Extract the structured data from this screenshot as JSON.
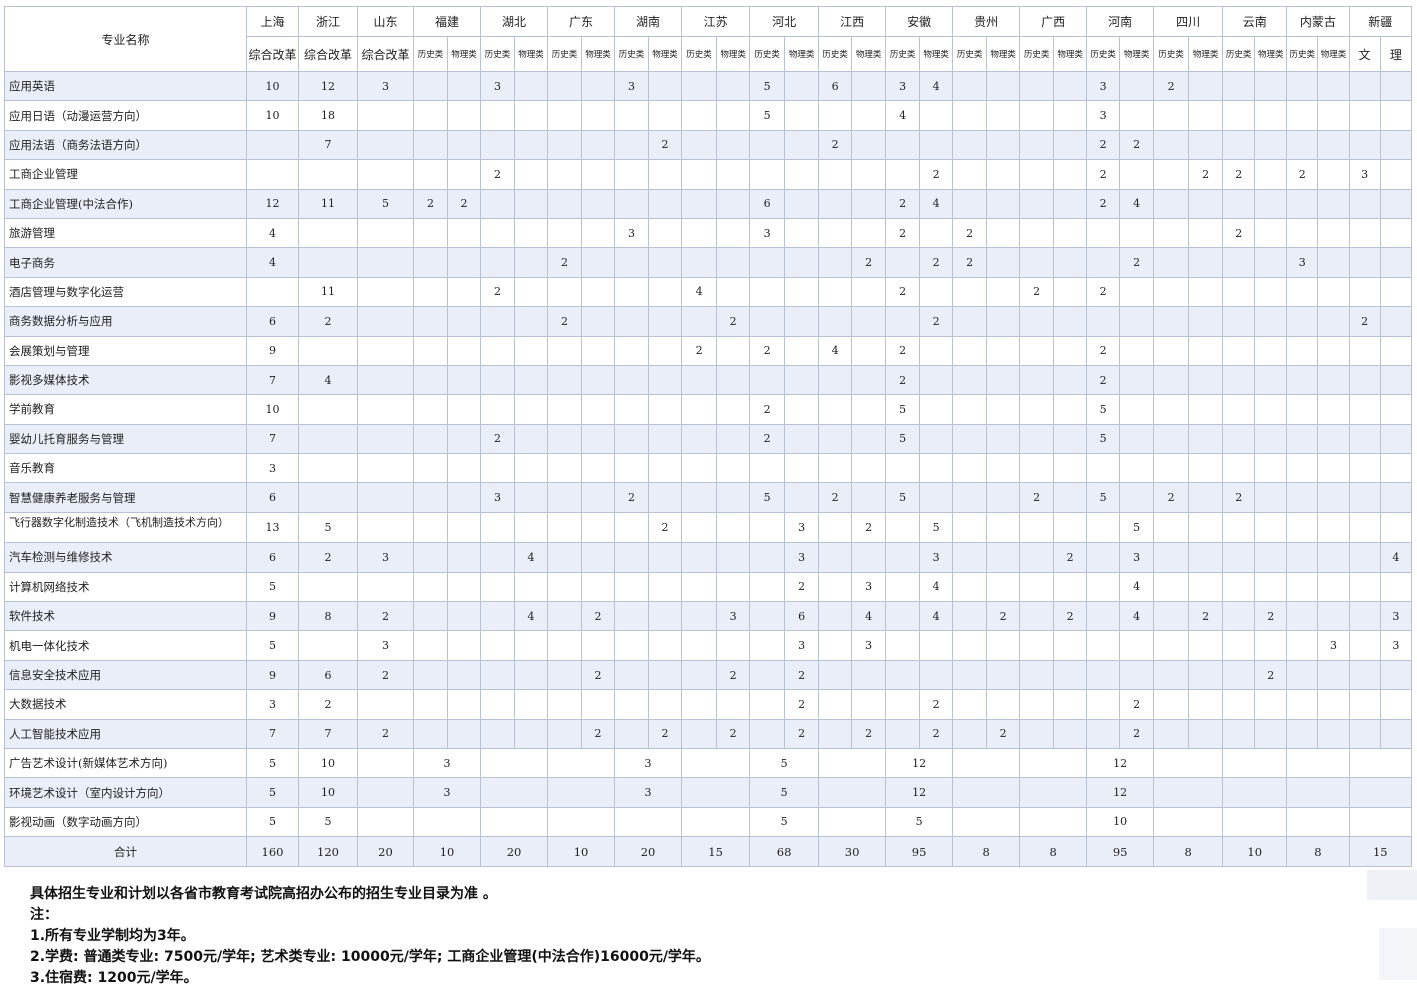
{
  "table": {
    "corner": "专业名称",
    "provinces": [
      {
        "name": "上海",
        "subs": [
          "综合改革"
        ]
      },
      {
        "name": "浙江",
        "subs": [
          "综合改革"
        ]
      },
      {
        "name": "山东",
        "subs": [
          "综合改革"
        ]
      },
      {
        "name": "福建",
        "subs": [
          "历史类",
          "物理类"
        ]
      },
      {
        "name": "湖北",
        "subs": [
          "历史类",
          "物理类"
        ]
      },
      {
        "name": "广东",
        "subs": [
          "历史类",
          "物理类"
        ]
      },
      {
        "name": "湖南",
        "subs": [
          "历史类",
          "物理类"
        ]
      },
      {
        "name": "江苏",
        "subs": [
          "历史类",
          "物理类"
        ]
      },
      {
        "name": "河北",
        "subs": [
          "历史类",
          "物理类"
        ]
      },
      {
        "name": "江西",
        "subs": [
          "历史类",
          "物理类"
        ]
      },
      {
        "name": "安徽",
        "subs": [
          "历史类",
          "物理类"
        ]
      },
      {
        "name": "贵州",
        "subs": [
          "历史类",
          "物理类"
        ]
      },
      {
        "name": "广西",
        "subs": [
          "历史类",
          "物理类"
        ]
      },
      {
        "name": "河南",
        "subs": [
          "历史类",
          "物理类"
        ]
      },
      {
        "name": "四川",
        "subs": [
          "历史类",
          "物理类"
        ]
      },
      {
        "name": "云南",
        "subs": [
          "历史类",
          "物理类"
        ]
      },
      {
        "name": "内蒙古",
        "subs": [
          "历史类",
          "物理类"
        ]
      },
      {
        "name": "新疆",
        "subs": [
          "文",
          "理"
        ]
      }
    ],
    "rows": [
      {
        "name": "应用英语",
        "cells": [
          {
            "c": 0,
            "v": "10"
          },
          {
            "c": 1,
            "v": "12"
          },
          {
            "c": 2,
            "v": "3"
          },
          {
            "c": 5,
            "v": "3"
          },
          {
            "c": 9,
            "v": "3"
          },
          {
            "c": 13,
            "v": "5"
          },
          {
            "c": 15,
            "v": "6"
          },
          {
            "c": 17,
            "v": "3"
          },
          {
            "c": 18,
            "v": "4"
          },
          {
            "c": 23,
            "v": "3"
          },
          {
            "c": 25,
            "v": "2"
          }
        ]
      },
      {
        "name": "应用日语（动漫运营方向）",
        "cells": [
          {
            "c": 0,
            "v": "10"
          },
          {
            "c": 1,
            "v": "18"
          },
          {
            "c": 13,
            "v": "5"
          },
          {
            "c": 17,
            "v": "4"
          },
          {
            "c": 23,
            "v": "3"
          }
        ]
      },
      {
        "name": "应用法语（商务法语方向）",
        "cells": [
          {
            "c": 1,
            "v": "7"
          },
          {
            "c": 10,
            "v": "2"
          },
          {
            "c": 15,
            "v": "2"
          },
          {
            "c": 23,
            "v": "2"
          },
          {
            "c": 24,
            "v": "2"
          }
        ]
      },
      {
        "name": "工商企业管理",
        "cells": [
          {
            "c": 5,
            "v": "2"
          },
          {
            "c": 18,
            "v": "2"
          },
          {
            "c": 23,
            "v": "2"
          },
          {
            "c": 26,
            "v": "2"
          },
          {
            "c": 27,
            "v": "2"
          },
          {
            "c": 29,
            "v": "2"
          },
          {
            "c": 31,
            "v": "3"
          }
        ]
      },
      {
        "name": "工商企业管理(中法合作)",
        "cells": [
          {
            "c": 0,
            "v": "12"
          },
          {
            "c": 1,
            "v": "11"
          },
          {
            "c": 2,
            "v": "5"
          },
          {
            "c": 3,
            "v": "2"
          },
          {
            "c": 4,
            "v": "2"
          },
          {
            "c": 13,
            "v": "6"
          },
          {
            "c": 17,
            "v": "2"
          },
          {
            "c": 18,
            "v": "4"
          },
          {
            "c": 23,
            "v": "2"
          },
          {
            "c": 24,
            "v": "4"
          }
        ]
      },
      {
        "name": "旅游管理",
        "cells": [
          {
            "c": 0,
            "v": "4"
          },
          {
            "c": 9,
            "v": "3"
          },
          {
            "c": 13,
            "v": "3"
          },
          {
            "c": 17,
            "v": "2"
          },
          {
            "c": 19,
            "v": "2"
          },
          {
            "c": 27,
            "v": "2"
          }
        ]
      },
      {
        "name": "电子商务",
        "cells": [
          {
            "c": 0,
            "v": "4"
          },
          {
            "c": 7,
            "v": "2"
          },
          {
            "c": 16,
            "v": "2"
          },
          {
            "c": 18,
            "v": "2"
          },
          {
            "c": 19,
            "v": "2"
          },
          {
            "c": 24,
            "v": "2"
          },
          {
            "c": 29,
            "v": "3"
          }
        ]
      },
      {
        "name": "酒店管理与数字化运营",
        "cells": [
          {
            "c": 1,
            "v": "11"
          },
          {
            "c": 5,
            "v": "2"
          },
          {
            "c": 11,
            "v": "4"
          },
          {
            "c": 17,
            "v": "2"
          },
          {
            "c": 21,
            "v": "2"
          },
          {
            "c": 23,
            "v": "2"
          }
        ]
      },
      {
        "name": "商务数据分析与应用",
        "cells": [
          {
            "c": 0,
            "v": "6"
          },
          {
            "c": 1,
            "v": "2"
          },
          {
            "c": 7,
            "v": "2"
          },
          {
            "c": 12,
            "v": "2"
          },
          {
            "c": 18,
            "v": "2"
          },
          {
            "c": 31,
            "v": "2"
          }
        ]
      },
      {
        "name": "会展策划与管理",
        "cells": [
          {
            "c": 0,
            "v": "9"
          },
          {
            "c": 11,
            "v": "2"
          },
          {
            "c": 13,
            "v": "2"
          },
          {
            "c": 15,
            "v": "4"
          },
          {
            "c": 17,
            "v": "2"
          },
          {
            "c": 23,
            "v": "2"
          }
        ]
      },
      {
        "name": "影视多媒体技术",
        "cells": [
          {
            "c": 0,
            "v": "7"
          },
          {
            "c": 1,
            "v": "4"
          },
          {
            "c": 17,
            "v": "2"
          },
          {
            "c": 23,
            "v": "2"
          }
        ]
      },
      {
        "name": "学前教育",
        "cells": [
          {
            "c": 0,
            "v": "10"
          },
          {
            "c": 13,
            "v": "2"
          },
          {
            "c": 17,
            "v": "5"
          },
          {
            "c": 23,
            "v": "5"
          }
        ]
      },
      {
        "name": "婴幼儿托育服务与管理",
        "cells": [
          {
            "c": 0,
            "v": "7"
          },
          {
            "c": 5,
            "v": "2"
          },
          {
            "c": 13,
            "v": "2"
          },
          {
            "c": 17,
            "v": "5"
          },
          {
            "c": 23,
            "v": "5"
          }
        ]
      },
      {
        "name": "音乐教育",
        "cells": [
          {
            "c": 0,
            "v": "3"
          }
        ]
      },
      {
        "name": "智慧健康养老服务与管理",
        "cells": [
          {
            "c": 0,
            "v": "6"
          },
          {
            "c": 5,
            "v": "3"
          },
          {
            "c": 9,
            "v": "2"
          },
          {
            "c": 13,
            "v": "5"
          },
          {
            "c": 15,
            "v": "2"
          },
          {
            "c": 17,
            "v": "5"
          },
          {
            "c": 21,
            "v": "2"
          },
          {
            "c": 23,
            "v": "5"
          },
          {
            "c": 25,
            "v": "2"
          },
          {
            "c": 27,
            "v": "2"
          }
        ]
      },
      {
        "name": "飞行器数字化制造技术（飞机制造技术方向）",
        "small": true,
        "cells": [
          {
            "c": 0,
            "v": "13"
          },
          {
            "c": 1,
            "v": "5"
          },
          {
            "c": 10,
            "v": "2"
          },
          {
            "c": 14,
            "v": "3"
          },
          {
            "c": 16,
            "v": "2"
          },
          {
            "c": 18,
            "v": "5"
          },
          {
            "c": 24,
            "v": "5"
          }
        ]
      },
      {
        "name": "汽车检测与维修技术",
        "cells": [
          {
            "c": 0,
            "v": "6"
          },
          {
            "c": 1,
            "v": "2"
          },
          {
            "c": 2,
            "v": "3"
          },
          {
            "c": 6,
            "v": "4"
          },
          {
            "c": 14,
            "v": "3"
          },
          {
            "c": 18,
            "v": "3"
          },
          {
            "c": 22,
            "v": "2"
          },
          {
            "c": 24,
            "v": "3"
          },
          {
            "c": 32,
            "v": "4"
          }
        ]
      },
      {
        "name": "计算机网络技术",
        "cells": [
          {
            "c": 0,
            "v": "5"
          },
          {
            "c": 14,
            "v": "2"
          },
          {
            "c": 16,
            "v": "3"
          },
          {
            "c": 18,
            "v": "4"
          },
          {
            "c": 24,
            "v": "4"
          }
        ]
      },
      {
        "name": "软件技术",
        "cells": [
          {
            "c": 0,
            "v": "9"
          },
          {
            "c": 1,
            "v": "8"
          },
          {
            "c": 2,
            "v": "2"
          },
          {
            "c": 6,
            "v": "4"
          },
          {
            "c": 8,
            "v": "2"
          },
          {
            "c": 12,
            "v": "3"
          },
          {
            "c": 14,
            "v": "6"
          },
          {
            "c": 16,
            "v": "4"
          },
          {
            "c": 18,
            "v": "4"
          },
          {
            "c": 20,
            "v": "2"
          },
          {
            "c": 22,
            "v": "2"
          },
          {
            "c": 24,
            "v": "4"
          },
          {
            "c": 26,
            "v": "2"
          },
          {
            "c": 28,
            "v": "2"
          },
          {
            "c": 32,
            "v": "3"
          }
        ]
      },
      {
        "name": "机电一体化技术",
        "cells": [
          {
            "c": 0,
            "v": "5"
          },
          {
            "c": 2,
            "v": "3"
          },
          {
            "c": 14,
            "v": "3"
          },
          {
            "c": 16,
            "v": "3"
          },
          {
            "c": 30,
            "v": "3"
          },
          {
            "c": 32,
            "v": "3"
          }
        ]
      },
      {
        "name": "信息安全技术应用",
        "cells": [
          {
            "c": 0,
            "v": "9"
          },
          {
            "c": 1,
            "v": "6"
          },
          {
            "c": 2,
            "v": "2"
          },
          {
            "c": 8,
            "v": "2"
          },
          {
            "c": 12,
            "v": "2"
          },
          {
            "c": 14,
            "v": "2"
          },
          {
            "c": 28,
            "v": "2"
          }
        ]
      },
      {
        "name": "大数据技术",
        "cells": [
          {
            "c": 0,
            "v": "3"
          },
          {
            "c": 1,
            "v": "2"
          },
          {
            "c": 14,
            "v": "2"
          },
          {
            "c": 18,
            "v": "2"
          },
          {
            "c": 24,
            "v": "2"
          }
        ]
      },
      {
        "name": "人工智能技术应用",
        "cells": [
          {
            "c": 0,
            "v": "7"
          },
          {
            "c": 1,
            "v": "7"
          },
          {
            "c": 2,
            "v": "2"
          },
          {
            "c": 8,
            "v": "2"
          },
          {
            "c": 10,
            "v": "2"
          },
          {
            "c": 12,
            "v": "2"
          },
          {
            "c": 14,
            "v": "2"
          },
          {
            "c": 16,
            "v": "2"
          },
          {
            "c": 18,
            "v": "2"
          },
          {
            "c": 20,
            "v": "2"
          },
          {
            "c": 24,
            "v": "2"
          }
        ]
      }
    ],
    "art_rows": [
      {
        "name": "广告艺术设计(新媒体艺术方向)",
        "vals": [
          "5",
          "10",
          "",
          "3",
          "",
          "",
          "3",
          "",
          "5",
          "",
          "12",
          "",
          "",
          "12",
          "",
          "",
          "",
          ""
        ]
      },
      {
        "name": "环境艺术设计（室内设计方向）",
        "vals": [
          "5",
          "10",
          "",
          "3",
          "",
          "",
          "3",
          "",
          "5",
          "",
          "12",
          "",
          "",
          "12",
          "",
          "",
          "",
          ""
        ]
      },
      {
        "name": "影视动画（数字动画方向）",
        "vals": [
          "5",
          "5",
          "",
          "",
          "",
          "",
          "",
          "",
          "5",
          "",
          "5",
          "",
          "",
          "10",
          "",
          "",
          "",
          ""
        ]
      }
    ],
    "total": {
      "label": "合计",
      "vals": [
        "160",
        "120",
        "20",
        "10",
        "20",
        "10",
        "20",
        "15",
        "68",
        "30",
        "95",
        "8",
        "8",
        "95",
        "8",
        "10",
        "8",
        "15"
      ]
    }
  },
  "notes": [
    "具体招生专业和计划以各省市教育考试院高招办公布的招生专业目录为准 。",
    "注：",
    "1.所有专业学制均为3年。",
    "2.学费: 普通类专业: 7500元/学年; 艺术类专业: 10000元/学年; 工商企业管理(中法合作)16000元/学年。",
    "3.住宿费: 1200元/学年。"
  ]
}
